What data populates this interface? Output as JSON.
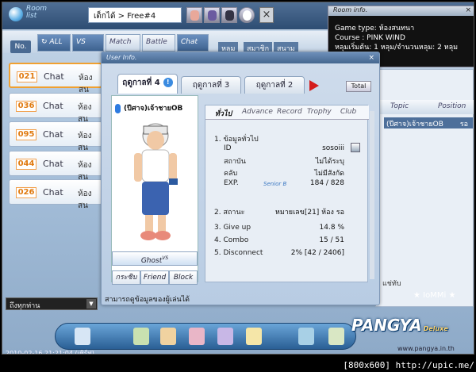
{
  "topbar": {
    "logo": "Room list",
    "crumb": "เด็กได้ > Free#4"
  },
  "tabs": {
    "no": "No.",
    "all": "ALL",
    "vs": "VS",
    "match": "Match",
    "battle": "Battle",
    "chat": "Chat",
    "f1": "หลุม",
    "f2": "สมาชิก",
    "f3": "สนาม"
  },
  "rows": [
    {
      "num": "021",
      "type": "Chat",
      "room": "ห้องสน"
    },
    {
      "num": "036",
      "type": "Chat",
      "room": "ห้องสน"
    },
    {
      "num": "095",
      "type": "Chat",
      "room": "ห้องสน"
    },
    {
      "num": "044",
      "type": "Chat",
      "room": "ห้องสน"
    },
    {
      "num": "026",
      "type": "Chat",
      "room": "ห้องสน"
    }
  ],
  "select": "ถึงทุกท่าน",
  "room_info": {
    "title": "Room info.",
    "line1": "Game type: ห้องสนทนา",
    "line2": "Course : PINK WIND",
    "line3": "หลุมเริ่มต้น: 1 หลุม/จำนวนหลุม: 2 หลุม"
  },
  "right": {
    "topic": "Topic",
    "position": "Position",
    "row_name": "(ปีศาจ)เจ้าชายOB",
    "row_pos": "รอ",
    "foot": "แช่ทับ",
    "iommi": "IoMMi"
  },
  "user_info": {
    "title": "User Info.",
    "season_tabs": [
      "ฤดูกาลที่ 4",
      "ฤดูกาลที่ 3",
      "ฤดูกาลที่ 2"
    ],
    "total": "Total",
    "name": "(ปีศาจ)เจ้าชายOB",
    "ghost": "Ghost",
    "ghost_sup": "VS",
    "btn_whisper": "กระซิบ",
    "btn_friend": "Friend",
    "btn_block": "Block",
    "stat_tabs": [
      "ทั่วไป",
      "Advance",
      "Record",
      "Trophy",
      "Club"
    ],
    "sec1": "1. ข้อมูลทั่วไป",
    "id_label": "ID",
    "id_val": "sosoiii",
    "inst_label": "สถาบัน",
    "inst_val": "ไม่ได้ระบุ",
    "club_label": "คลับ",
    "club_val": "ไม่มีสังกัด",
    "exp_label": "EXP.",
    "exp_rank": "Senior B",
    "exp_val": "184 / 828",
    "sec2": "2. สถานะ",
    "status_val": "หมายเลข[21] ห้อง รอ",
    "giveup_label": "3. Give up",
    "giveup_val": "14.8 %",
    "combo_label": "4. Combo",
    "combo_val": "15 / 51",
    "disc_label": "5. Disconnect",
    "disc_val": "2% [42 / 2406]",
    "footnote": "สามารถดูข้อมูลของผู้เล่นได้"
  },
  "logo": {
    "main": "PANGYA",
    "sub": "Deluxe"
  },
  "website": "www.pangya.in.th",
  "timestamp": "2010-02-16 21:21:04 (เซิร์ฟ)",
  "watermark": "[800x600] http://upic.me/"
}
